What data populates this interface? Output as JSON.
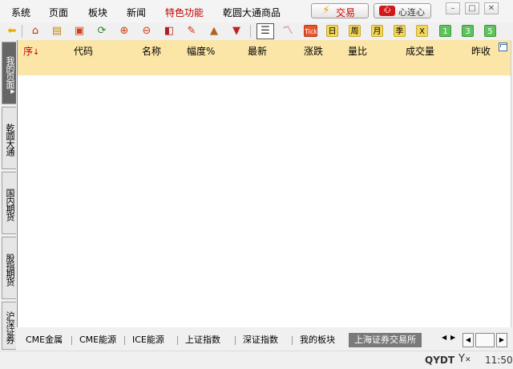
{
  "menu": {
    "items": [
      "系统",
      "页面",
      "板块",
      "新闻",
      "特色功能",
      "乾圆大通商品"
    ],
    "trade_label": "交易",
    "heart_label": "心连心",
    "heart_badge": "心"
  },
  "toolbar": {
    "tick_label": "Tick",
    "day": "日",
    "week": "周",
    "month": "月",
    "season": "季",
    "x": "X",
    "n1": "1",
    "n3": "3",
    "n5": "5"
  },
  "sidebar": {
    "tabs": [
      "我的页面",
      "乾圆大通",
      "国内期货",
      "股指期货",
      "沪深证券"
    ]
  },
  "table": {
    "columns": [
      "序",
      "代码",
      "名称",
      "幅度%",
      "最新",
      "涨跌",
      "量比",
      "成交量",
      "昨收"
    ],
    "sort_arrow": "↓"
  },
  "bottom_tabs": {
    "items": [
      "CME金属",
      "CME能源",
      "ICE能源",
      "上证指数",
      "深证指数",
      "我的板块",
      "上海证券交易所"
    ]
  },
  "status": {
    "code": "QYDT",
    "time": "11:50"
  },
  "colors": {
    "header_bg": "#fbe6a8",
    "accent_red": "#c00000"
  }
}
